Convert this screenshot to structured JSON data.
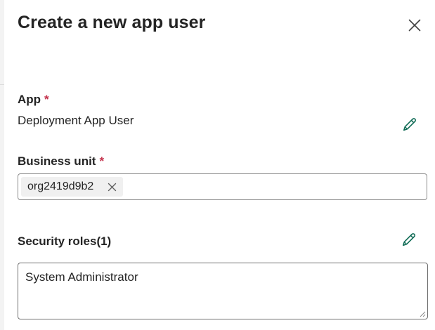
{
  "panel": {
    "title": "Create a new app user",
    "close_icon": "close-icon"
  },
  "app_field": {
    "label": "App",
    "required_mark": "*",
    "value": "Deployment App User",
    "edit_icon": "pencil-edit-icon"
  },
  "business_unit": {
    "label": "Business unit",
    "required_mark": "*",
    "tags": [
      {
        "label": "org2419d9b2",
        "remove_icon": "dismiss-icon"
      }
    ]
  },
  "security_roles": {
    "label": "Security roles(1)",
    "edit_icon": "pencil-edit-icon",
    "value": "System Administrator"
  },
  "colors": {
    "required": "#c4314b",
    "edit_icon": "#0f6b55",
    "text": "#242424"
  }
}
